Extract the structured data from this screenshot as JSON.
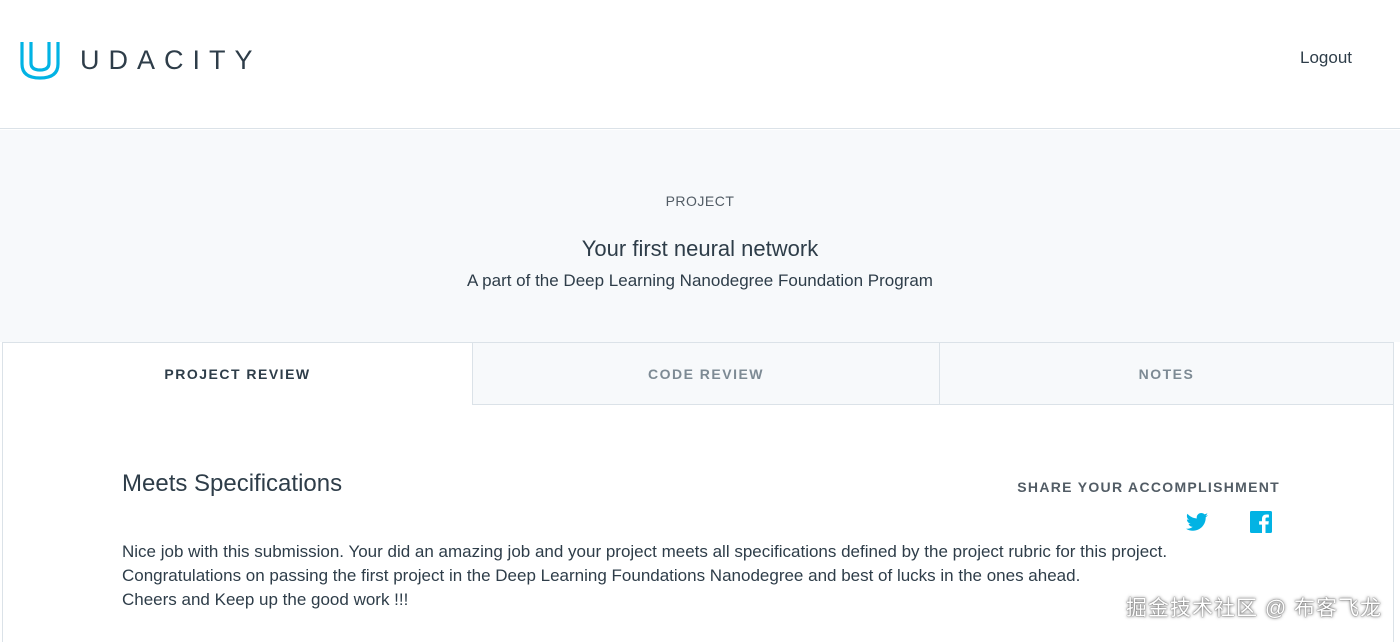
{
  "header": {
    "brand": "UDACITY",
    "logout_label": "Logout",
    "brand_color": "#02b3e4",
    "logo_icon": "udacity-logo-icon"
  },
  "hero": {
    "eyebrow": "PROJECT",
    "title": "Your first neural network",
    "subtitle": "A part of the Deep Learning Nanodegree Foundation Program"
  },
  "tabs": [
    {
      "label": "PROJECT REVIEW",
      "active": true
    },
    {
      "label": "CODE REVIEW",
      "active": false
    },
    {
      "label": "NOTES",
      "active": false
    }
  ],
  "review": {
    "status": "Meets Specifications",
    "share_label": "SHARE YOUR ACCOMPLISHMENT",
    "share_icons": [
      "twitter-icon",
      "facebook-icon"
    ],
    "share_color": "#02b3e4",
    "lines": [
      "Nice job with this submission. Your did an amazing job and your project meets all specifications defined by the project rubric for this project.",
      "Congratulations on passing the first project in the Deep Learning Foundations Nanodegree and best of lucks in the ones ahead.",
      "Cheers and Keep up the good work !!!"
    ]
  },
  "watermark": "掘金技术社区 @ 布客飞龙"
}
